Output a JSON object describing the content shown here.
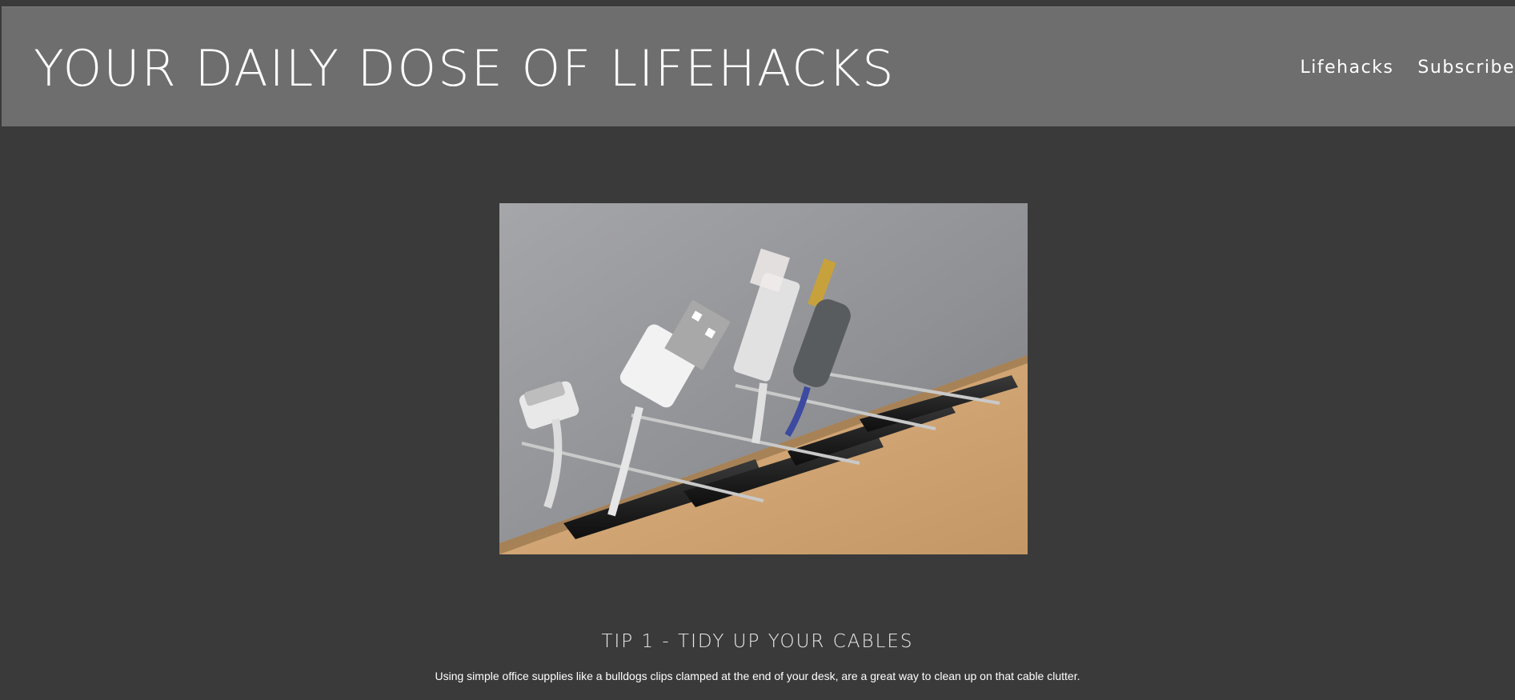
{
  "header": {
    "site_title": "YOUR DAILY DOSE OF LIFEHACKS",
    "nav": [
      {
        "label": "Lifehacks"
      },
      {
        "label": "Subscribe"
      }
    ]
  },
  "main": {
    "hero_image": {
      "alt": "Cables held by binder clips at the edge of a desk"
    },
    "tip": {
      "title": "TIP 1 - TIDY UP YOUR CABLES",
      "text": "Using simple office supplies like a bulldogs clips clamped at the end of your desk, are a great way to clean up on that cable clutter."
    }
  },
  "colors": {
    "page_background": "#3a3a3a",
    "header_background": "#6e6e6e",
    "text": "#ffffff"
  }
}
